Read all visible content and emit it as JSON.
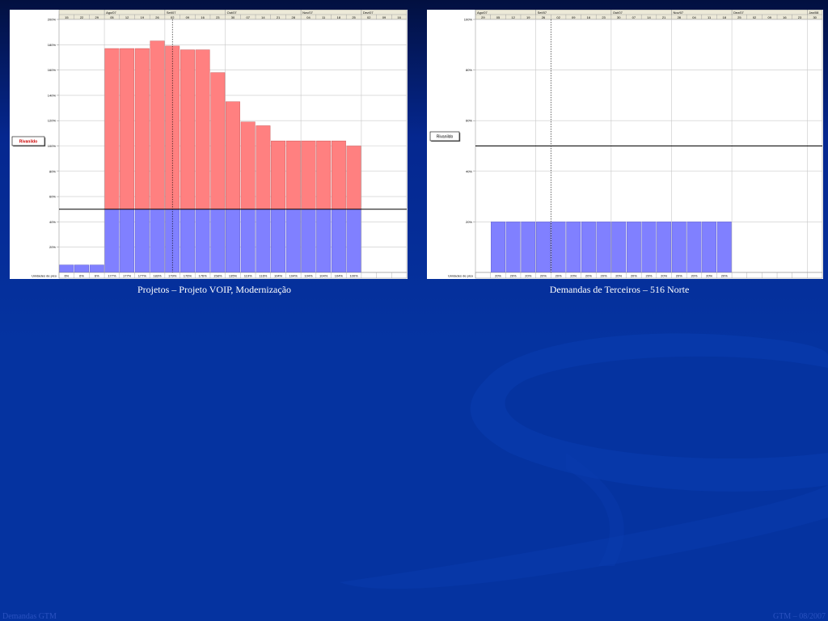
{
  "charts": [
    {
      "caption": "Projetos – Projeto VOIP, Modernização",
      "months": [
        "Ago/07",
        "Set/07",
        "Out/07",
        "Nov/07",
        "Dez/07"
      ],
      "weeks": [
        "15",
        "22",
        "29",
        "05",
        "12",
        "19",
        "26",
        "02",
        "09",
        "16",
        "23",
        "30",
        "07",
        "14",
        "21",
        "28",
        "04",
        "11",
        "18",
        "25",
        "02",
        "09",
        "16"
      ],
      "marker": "Rivanildo",
      "row_label": "Unidades de pico",
      "colors": {
        "over": "#ff8080",
        "base": "#8080ff",
        "marker_text": "#cc0000"
      }
    },
    {
      "caption": "Demandas de Terceiros – 516 Norte",
      "months": [
        "Ago/07",
        "Set/07",
        "Out/07",
        "Nov/07",
        "Dez/07",
        "Jan/08"
      ],
      "weeks": [
        "29",
        "05",
        "12",
        "19",
        "26",
        "02",
        "09",
        "16",
        "23",
        "30",
        "07",
        "14",
        "21",
        "28",
        "04",
        "11",
        "18",
        "25",
        "02",
        "09",
        "16",
        "23",
        "30"
      ],
      "marker": "Rivanildo",
      "row_label": "Unidades de pico",
      "colors": {
        "over": "#ff8080",
        "base": "#8080ff",
        "marker_text": "#000000"
      }
    }
  ],
  "chart_data": [
    {
      "type": "bar",
      "title": "Projetos – Projeto VOIP, Modernização",
      "categories": [
        "15",
        "22",
        "29",
        "05",
        "12",
        "19",
        "26",
        "02",
        "09",
        "16",
        "23",
        "30",
        "07",
        "14",
        "21",
        "28",
        "04",
        "11",
        "18",
        "25",
        "02",
        "09",
        "16"
      ],
      "y_unit": "%",
      "ylim": [
        0,
        200
      ],
      "yticks": [
        20,
        40,
        60,
        80,
        100,
        120,
        140,
        160,
        180,
        200
      ],
      "capacity_line": 50,
      "values": [
        6,
        6,
        6,
        177,
        177,
        177,
        183,
        179,
        176,
        176,
        158,
        135,
        119,
        116,
        104,
        104,
        104,
        104,
        104,
        100,
        null,
        null,
        null
      ],
      "value_labels": [
        "6%",
        "6%",
        "6%",
        "177%",
        "177%",
        "177%",
        "183%",
        "179%",
        "176%",
        "176%",
        "158%",
        "135%",
        "119%",
        "116%",
        "104%",
        "104%",
        "104%",
        "104%",
        "104%",
        "100%",
        "",
        "",
        ""
      ],
      "grid": true
    },
    {
      "type": "bar",
      "title": "Demandas de Terceiros – 516 Norte",
      "categories": [
        "29",
        "05",
        "12",
        "19",
        "26",
        "02",
        "09",
        "16",
        "23",
        "30",
        "07",
        "14",
        "21",
        "28",
        "04",
        "11",
        "18",
        "25",
        "02",
        "09",
        "16",
        "23",
        "30"
      ],
      "y_unit": "%",
      "ylim": [
        0,
        100
      ],
      "yticks": [
        20,
        40,
        60,
        80,
        100
      ],
      "capacity_line": 50,
      "values": [
        null,
        20,
        20,
        20,
        20,
        20,
        20,
        20,
        20,
        20,
        20,
        20,
        20,
        20,
        20,
        20,
        20,
        null,
        null,
        null,
        null,
        null,
        null
      ],
      "value_labels": [
        "",
        "20%",
        "20%",
        "20%",
        "20%",
        "20%",
        "20%",
        "20%",
        "20%",
        "20%",
        "20%",
        "20%",
        "20%",
        "20%",
        "20%",
        "20%",
        "20%",
        "",
        "",
        "",
        "",
        "",
        ""
      ],
      "grid": true
    }
  ],
  "footer": {
    "left": "Demandas GTM",
    "right": "GTM – 08/2007"
  }
}
